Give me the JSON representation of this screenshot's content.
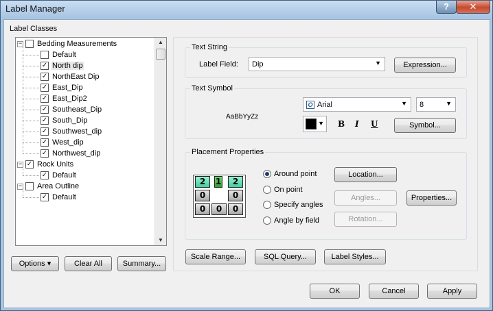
{
  "window": {
    "title": "Label Manager",
    "help_glyph": "?",
    "close_glyph": "✕"
  },
  "label_classes": {
    "title": "Label Classes",
    "tree": [
      {
        "label": "Bedding Measurements",
        "level": 0,
        "expander": "−",
        "checked": false
      },
      {
        "label": "Default",
        "level": 1,
        "checked": false
      },
      {
        "label": "North dip",
        "level": 1,
        "checked": true,
        "selected": true
      },
      {
        "label": "NorthEast Dip",
        "level": 1,
        "checked": true
      },
      {
        "label": "East_Dip",
        "level": 1,
        "checked": true
      },
      {
        "label": "East_Dip2",
        "level": 1,
        "checked": true
      },
      {
        "label": "Southeast_Dip",
        "level": 1,
        "checked": true
      },
      {
        "label": "South_Dip",
        "level": 1,
        "checked": true
      },
      {
        "label": "Southwest_dip",
        "level": 1,
        "checked": true
      },
      {
        "label": "West_dip",
        "level": 1,
        "checked": true
      },
      {
        "label": "Northwest_dip",
        "level": 1,
        "checked": true
      },
      {
        "label": "Rock Units",
        "level": 0,
        "expander": "−",
        "checked": true
      },
      {
        "label": "Default",
        "level": 1,
        "checked": true
      },
      {
        "label": "Area Outline",
        "level": 0,
        "expander": "−",
        "checked": false
      },
      {
        "label": "Default",
        "level": 1,
        "checked": true
      }
    ],
    "check_glyph": "✓",
    "buttons": {
      "options": "Options",
      "options_arrow": "▾",
      "clear_all": "Clear All",
      "summary": "Summary..."
    }
  },
  "text_string": {
    "title": "Text String",
    "label_field_label": "Label Field:",
    "label_field_value": "Dip",
    "expression_button": "Expression..."
  },
  "text_symbol": {
    "title": "Text Symbol",
    "preview": "AaBbYyZz",
    "font_icon_glyph": "O",
    "font_name": "Arial",
    "font_size": "8",
    "color": "#000000",
    "bold": "B",
    "italic": "I",
    "underline": "U",
    "symbol_button": "Symbol..."
  },
  "placement": {
    "title": "Placement Properties",
    "grid": [
      [
        "2",
        "1",
        "2"
      ],
      [
        "0",
        "",
        "0"
      ],
      [
        "0",
        "0",
        "0"
      ]
    ],
    "options": [
      {
        "label": "Around point",
        "checked": true
      },
      {
        "label": "On point",
        "checked": false
      },
      {
        "label": "Specify angles",
        "checked": false
      },
      {
        "label": "Angle by field",
        "checked": false
      }
    ],
    "buttons": {
      "location": "Location...",
      "angles": "Angles...",
      "properties": "Properties...",
      "rotation": "Rotation..."
    }
  },
  "lower_buttons": {
    "scale_range": "Scale Range...",
    "sql_query": "SQL Query...",
    "label_styles": "Label Styles..."
  },
  "dialog_buttons": {
    "ok": "OK",
    "cancel": "Cancel",
    "apply": "Apply"
  },
  "arrow_glyph": "▼"
}
